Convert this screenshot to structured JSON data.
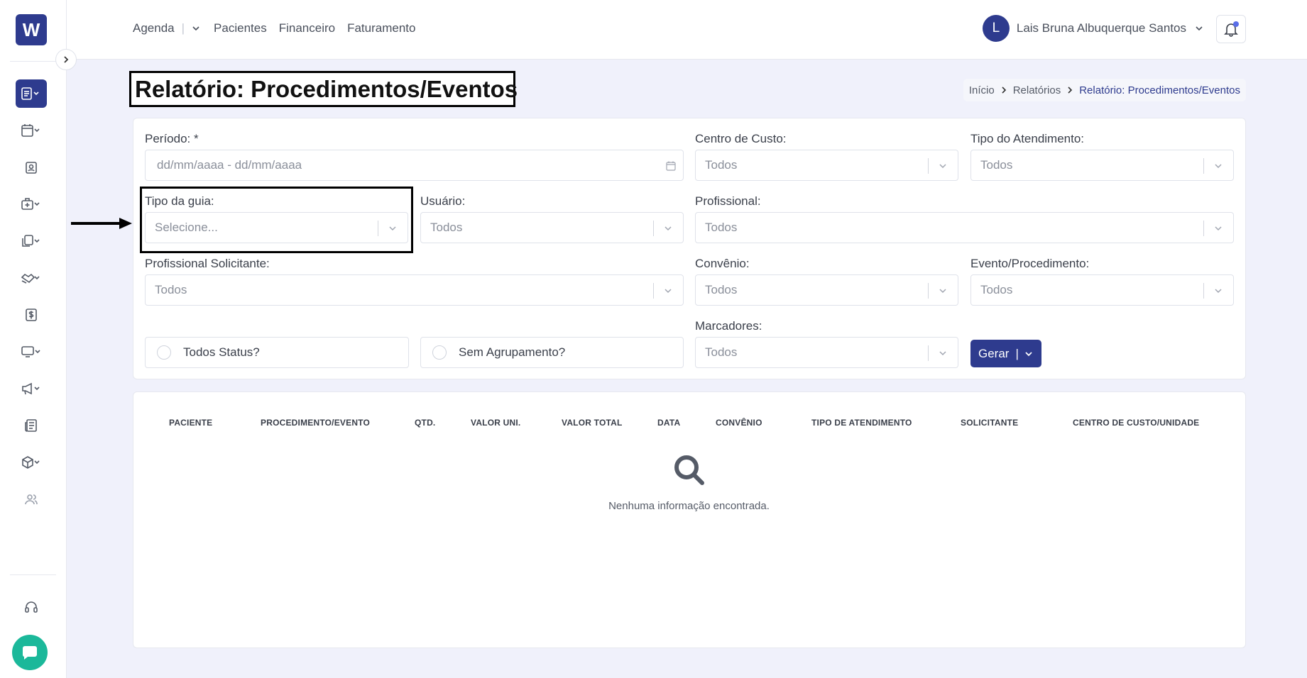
{
  "app": {
    "logo_text": "W",
    "accent": "#2e3b8e",
    "chat_color": "#1bb89a"
  },
  "topnav": {
    "agenda": "Agenda",
    "pacientes": "Pacientes",
    "financeiro": "Financeiro",
    "faturamento": "Faturamento"
  },
  "user": {
    "initial": "L",
    "name": "Lais Bruna Albuquerque Santos"
  },
  "sidebar": {
    "icons": [
      "report-icon",
      "calendar-icon",
      "patient-badge-icon",
      "medical-bag-icon",
      "documents-icon",
      "handshake-icon",
      "dollar-icon",
      "monitor-icon",
      "megaphone-icon",
      "newspaper-icon",
      "package-icon",
      "users-icon",
      "headset-icon",
      "chat-icon"
    ]
  },
  "page": {
    "title": "Relatório: Procedimentos/Eventos"
  },
  "breadcrumb": {
    "home": "Início",
    "reports": "Relatórios",
    "current": "Relatório: Procedimentos/Eventos"
  },
  "form": {
    "periodo": {
      "label": "Período: *",
      "placeholder": "dd/mm/aaaa - dd/mm/aaaa"
    },
    "centro_custo": {
      "label": "Centro de Custo:",
      "value": "Todos"
    },
    "tipo_atendimento": {
      "label": "Tipo do Atendimento:",
      "value": "Todos"
    },
    "tipo_guia": {
      "label": "Tipo da guia:",
      "value": "Selecione..."
    },
    "usuario": {
      "label": "Usuário:",
      "value": "Todos"
    },
    "profissional": {
      "label": "Profissional:",
      "value": "Todos"
    },
    "prof_solicitante": {
      "label": "Profissional Solicitante:",
      "value": "Todos"
    },
    "convenio": {
      "label": "Convênio:",
      "value": "Todos"
    },
    "evento": {
      "label": "Evento/Procedimento:",
      "value": "Todos"
    },
    "marcadores": {
      "label": "Marcadores:",
      "value": "Todos"
    },
    "todos_status": "Todos Status?",
    "sem_agrupamento": "Sem Agrupamento?",
    "gerar": "Gerar",
    "gerar_sep": "|"
  },
  "table": {
    "headers": [
      "PACIENTE",
      "PROCEDIMENTO/EVENTO",
      "QTD.",
      "VALOR UNI.",
      "VALOR TOTAL",
      "DATA",
      "CONVÊNIO",
      "TIPO DE ATENDIMENTO",
      "SOLICITANTE",
      "CENTRO DE CUSTO/UNIDADE"
    ],
    "empty": "Nenhuma informação encontrada."
  }
}
